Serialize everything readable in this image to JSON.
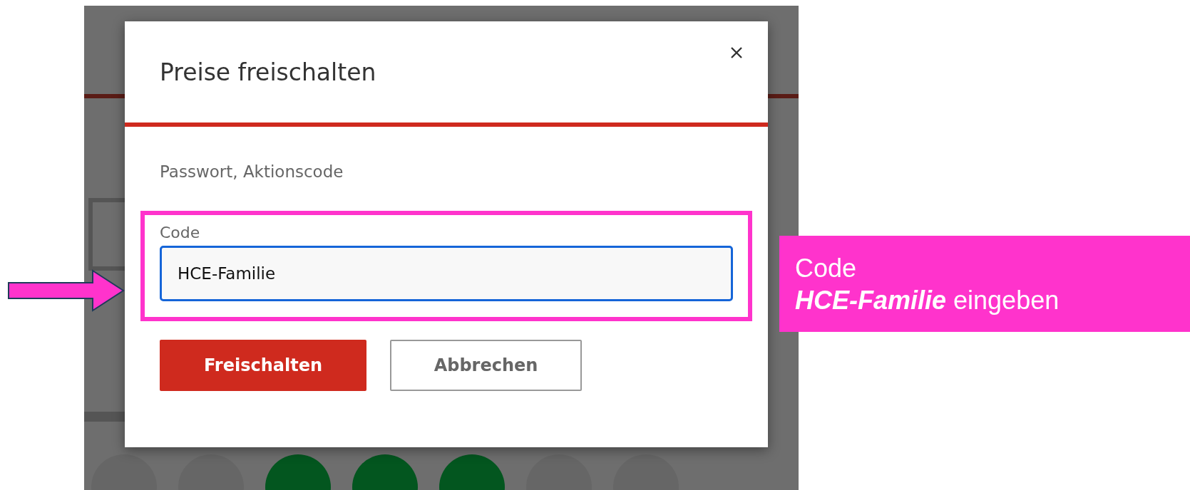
{
  "dialog": {
    "title": "Preise freischalten",
    "description": "Passwort, Aktionscode",
    "field": {
      "label": "Code",
      "value": "HCE-Familie",
      "focused": true
    },
    "buttons": [
      {
        "label": "Freischalten",
        "kind": "primary"
      },
      {
        "label": "Abbrechen",
        "kind": "secondary"
      }
    ]
  },
  "callout": {
    "lines": [
      "Code",
      "**HCE-Familie** eingeben"
    ]
  }
}
